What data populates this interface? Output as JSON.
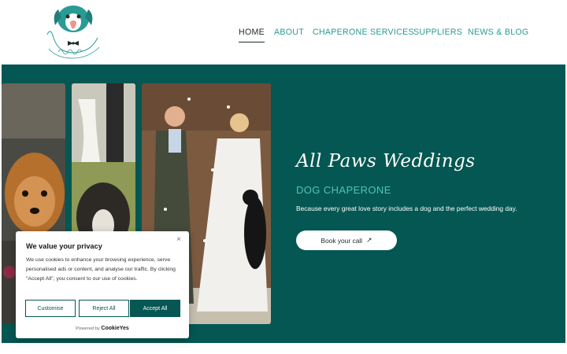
{
  "header": {
    "logo_text": "All Paws Weddings",
    "nav": [
      {
        "label": "HOME",
        "active": true
      },
      {
        "label": "ABOUT",
        "active": false
      },
      {
        "label": "CHAPERONE SERVICES",
        "active": false
      },
      {
        "label": "SUPPLIERS",
        "active": false
      },
      {
        "label": "NEWS & BLOG",
        "active": false
      }
    ]
  },
  "hero": {
    "title": "All Paws Weddings",
    "subtitle": "DOG CHAPERONE",
    "tagline": "Because every great love story includes a dog and the perfect wedding day.",
    "cta_label": "Book your call",
    "cta_icon": "arrow-up-right-icon"
  },
  "cookie_banner": {
    "title": "We value your privacy",
    "close": "×",
    "text": "We use cookies to enhance your browsing experience, serve personalised ads or content, and analyse our traffic. By clicking \"Accept All\", you consent to our use of cookies.",
    "buttons": {
      "customise": "Customise",
      "reject": "Reject All",
      "accept": "Accept All"
    },
    "powered_prefix": "Powered by",
    "powered_brand": "CookieYes"
  },
  "colors": {
    "brand_teal": "#045752",
    "accent_teal": "#2a9a94",
    "subtitle_teal": "#52c3bb"
  }
}
